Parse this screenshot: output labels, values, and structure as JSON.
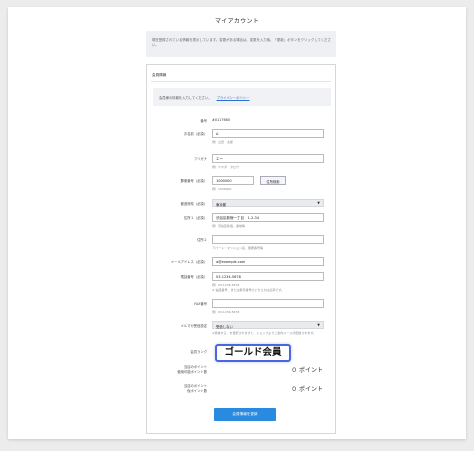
{
  "page_title": "マイアカウント",
  "notice_text": "現在登録されている情報を表示しています。変更がある場合は、変更を入力後、「更新」ボタンをクリックしてください。",
  "panel_title": "会員情報",
  "info": {
    "text": "会員様の情報を入力してください。",
    "privacy_link": "プライバシーポリシー"
  },
  "fields": {
    "member_no": {
      "label": "番号",
      "value": "#0117660"
    },
    "name": {
      "label": "お名前",
      "req": "（必須）",
      "value": "A",
      "hint": "例）山田　太郎"
    },
    "kana": {
      "label": "フリガナ",
      "value": "エー",
      "hint": "例）ヤマダ　タロウ"
    },
    "zip": {
      "label": "郵便番号",
      "req": "（必須）",
      "value": "1000000",
      "hint": "例）1000000",
      "button": "住所検索"
    },
    "pref": {
      "label": "都道府県",
      "req": "（必須）",
      "value": "東京都",
      "arrow": "▼"
    },
    "address1": {
      "label": "住所１",
      "req": "（必須）",
      "value": "渋谷区新宿一丁目　1-2-34",
      "hint": "例）渋谷区新宿、番地等"
    },
    "address2": {
      "label": "住所２",
      "value": "",
      "hint": "アパート・マンション名、部屋番号等"
    },
    "email": {
      "label": "メールアドレス",
      "req": "（必須）",
      "value": "a@example.com"
    },
    "phone": {
      "label": "電話番号",
      "req": "（必須）",
      "value": "03-1234-5678",
      "hint": "例）03-1234-5678",
      "hint2": "※ 電話番号、または携帯番号のどちらかは必須です。"
    },
    "fax": {
      "label": "FAX番号",
      "value": "",
      "hint": "例）03-1234-5678"
    },
    "mailmag": {
      "label": "メルマガ受信設定",
      "value": "受信しない",
      "arrow": "▼",
      "hint": "※受信する、を選択されますと、ショップよりご案内メールが配信されます。"
    },
    "rank": {
      "label": "会員ランク",
      "value": "ゴールド会員"
    },
    "points_current": {
      "label_line1": "当店のポイント",
      "label_line2": "使用可能ポイント数",
      "value": "０ ポイント"
    },
    "points_pending": {
      "label_line1": "当店のポイント",
      "label_line2": "仮ポイント数",
      "value": "０ ポイント"
    }
  },
  "submit_label": "会員情報を更新",
  "colors": {
    "accent": "#2a8ae0",
    "rank_border": "#4a68d8",
    "link": "#2f6fcf"
  }
}
